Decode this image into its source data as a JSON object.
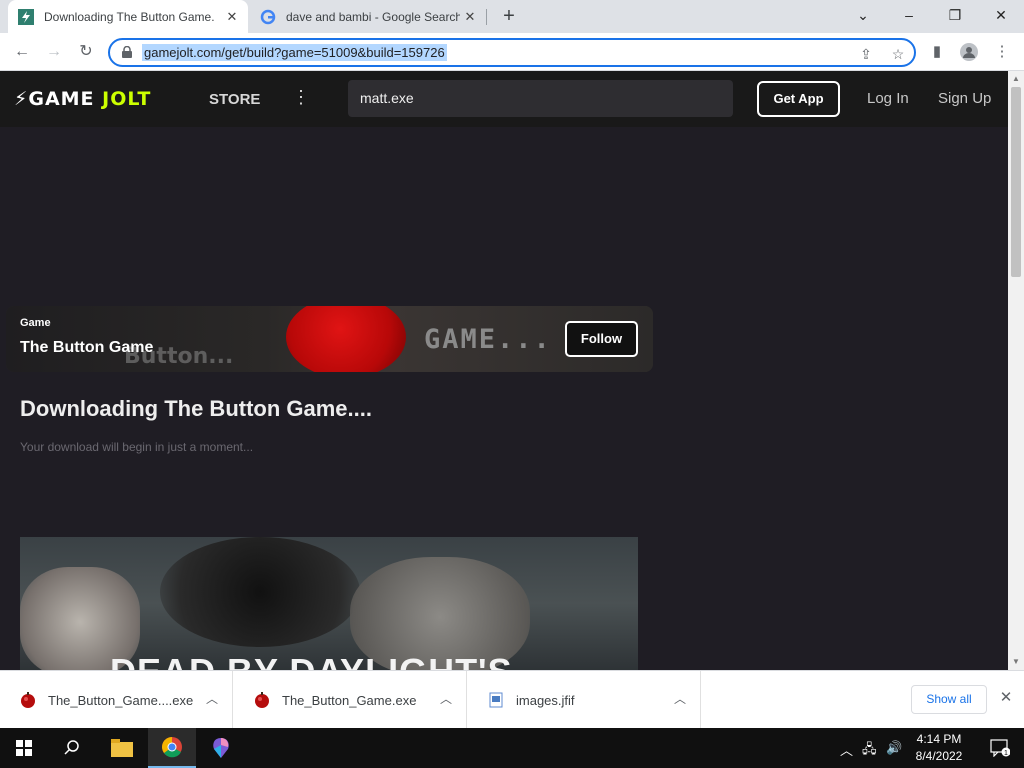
{
  "browser": {
    "tabs": [
      {
        "title": "Downloading The Button Game."
      },
      {
        "title": "dave and bambi - Google Search"
      }
    ],
    "url": "gamejolt.com/get/build?game=51009&build=159726"
  },
  "gamejolt": {
    "logo_part1": "GAME",
    "logo_part2": "JOLT",
    "store_label": "STORE",
    "search_value": "matt.exe",
    "get_app_label": "Get App",
    "login_label": "Log In",
    "signup_label": "Sign Up"
  },
  "game_card": {
    "kicker": "Game",
    "title": "The Button Game",
    "art_text_left": "Button...",
    "art_text_right": "GAME...",
    "follow_label": "Follow"
  },
  "download": {
    "heading": "Downloading The Button Game....",
    "subtext": "Your download will begin in just a moment..."
  },
  "ad": {
    "text": "DEAD BY DAYLIGHT'S"
  },
  "downloads_shelf": {
    "items": [
      {
        "name": "The_Button_Game....exe"
      },
      {
        "name": "The_Button_Game.exe"
      },
      {
        "name": "images.jfif"
      }
    ],
    "show_all_label": "Show all"
  },
  "taskbar": {
    "time": "4:14 PM",
    "date": "8/4/2022",
    "notification_count": "1"
  },
  "colors": {
    "accent": "#1a73e8",
    "jolt_green": "#ccff00",
    "page_bg": "#1f1d24"
  }
}
